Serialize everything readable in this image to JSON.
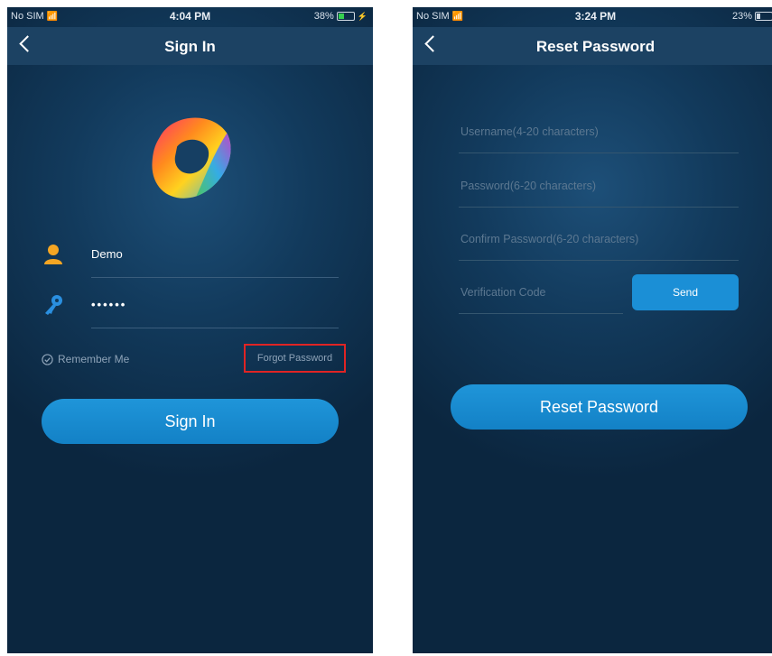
{
  "signin_screen": {
    "status": {
      "carrier": "No SIM",
      "time": "4:04 PM",
      "battery": "38%",
      "battery_level": 0.38
    },
    "nav": {
      "title": "Sign In"
    },
    "username_value": "Demo",
    "password_value": "••••••",
    "remember_label": "Remember Me",
    "forgot_label": "Forgot Password",
    "signin_label": "Sign In"
  },
  "reset_screen": {
    "status": {
      "carrier": "No SIM",
      "time": "3:24 PM",
      "battery": "23%",
      "battery_level": 0.23
    },
    "nav": {
      "title": "Reset Password"
    },
    "username_placeholder": "Username(4-20 characters)",
    "password_placeholder": "Password(6-20 characters)",
    "confirm_placeholder": "Confirm Password(6-20 characters)",
    "code_placeholder": "Verification Code",
    "send_label": "Send",
    "reset_label": "Reset Password"
  },
  "colors": {
    "accent": "#1b8fd6",
    "highlight_border": "#e02424",
    "nav_background": "#1c4263",
    "user_icon": "#f5a623",
    "key_icon": "#2a8fe0"
  },
  "icons": [
    "back-icon",
    "wifi-icon",
    "battery-icon",
    "logo-icon",
    "user-icon",
    "key-icon",
    "check-icon"
  ]
}
